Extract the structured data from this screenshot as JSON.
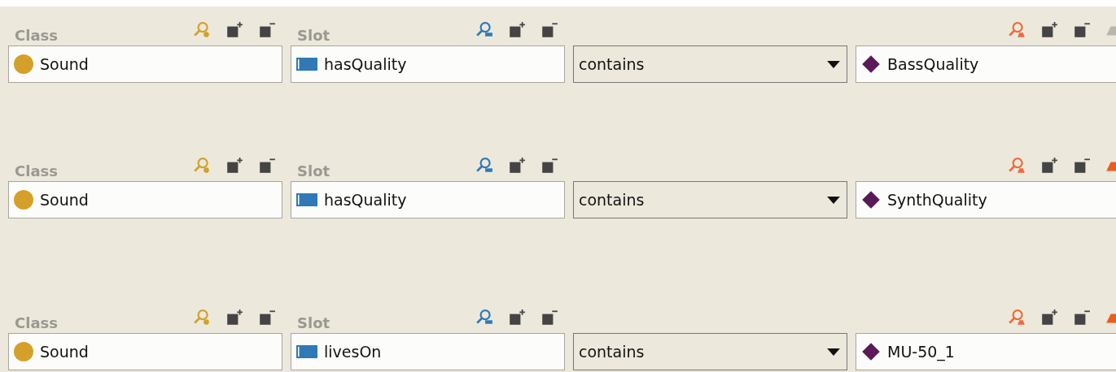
{
  "blocks": [
    {
      "class": {
        "label": "Class",
        "value": "Sound"
      },
      "slot": {
        "label": "Slot",
        "value": "hasQuality"
      },
      "operator": "contains",
      "filler": {
        "value": "BassQuality",
        "last_tool_enabled": false
      }
    },
    {
      "class": {
        "label": "Class",
        "value": "Sound"
      },
      "slot": {
        "label": "Slot",
        "value": "hasQuality"
      },
      "operator": "contains",
      "filler": {
        "value": "SynthQuality",
        "last_tool_enabled": true
      }
    },
    {
      "class": {
        "label": "Class",
        "value": "Sound"
      },
      "slot": {
        "label": "Slot",
        "value": "livesOn"
      },
      "operator": "contains",
      "filler": {
        "value": "MU-50_1",
        "last_tool_enabled": true
      }
    }
  ]
}
